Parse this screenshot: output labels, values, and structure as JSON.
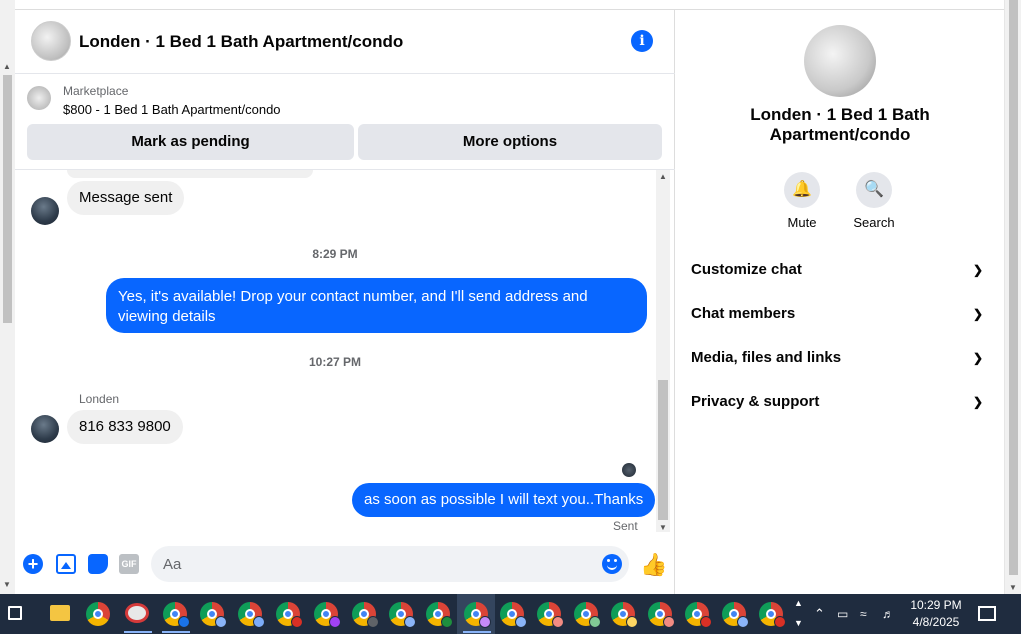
{
  "chat": {
    "title": "Londen · 1 Bed 1 Bath Apartment/condo",
    "marketplace": {
      "source": "Marketplace",
      "listing": "$800 - 1 Bed 1 Bath Apartment/condo",
      "pending_label": "Mark as pending",
      "more_label": "More options"
    },
    "messages": {
      "msg1": "Message sent",
      "time1": "8:29 PM",
      "msg2": "Yes, it's available! Drop your contact number, and I'll send address and viewing details",
      "time2": "10:27 PM",
      "sender": "Londen",
      "msg3": "816 833 9800",
      "msg4": "as soon as possible I will text you..Thanks",
      "status": "Sent"
    },
    "composer": {
      "placeholder": "Aa",
      "gif_label": "GIF"
    }
  },
  "details": {
    "title": "Londen · 1 Bed 1 Bath Apartment/condo",
    "actions": [
      {
        "label": "Mute",
        "icon": "bell-icon"
      },
      {
        "label": "Search",
        "icon": "search-icon"
      }
    ],
    "sections": [
      {
        "label": "Customize chat"
      },
      {
        "label": "Chat members"
      },
      {
        "label": "Media, files and links"
      },
      {
        "label": "Privacy & support"
      }
    ]
  },
  "taskbar": {
    "time": "10:29 PM",
    "date": "4/8/2025"
  },
  "colors": {
    "accent": "#0866ff",
    "bubble_in": "#f0f0f0",
    "button_bg": "#e4e6eb",
    "taskbar": "#1f2c3f"
  }
}
